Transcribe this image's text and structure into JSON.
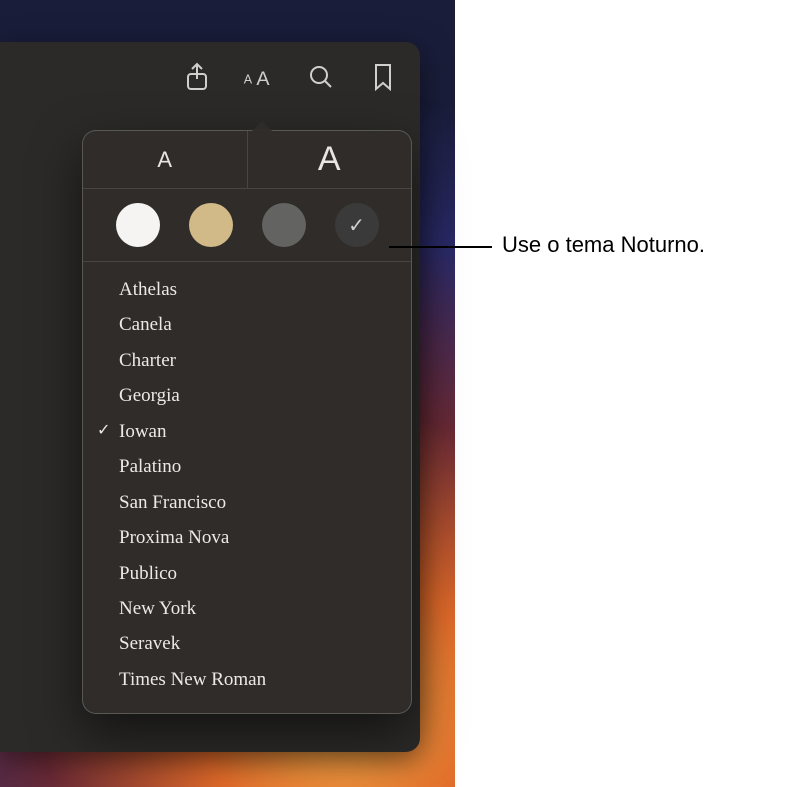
{
  "toolbar": {
    "share_name": "share-icon",
    "appearance_name": "appearance-icon",
    "search_name": "search-icon",
    "bookmark_name": "bookmark-icon"
  },
  "popover": {
    "size_small_label": "A",
    "size_large_label": "A",
    "themes": {
      "white": {
        "color": "#f5f4f2"
      },
      "sepia": {
        "color": "#d1b988"
      },
      "gray": {
        "color": "#636361"
      },
      "night": {
        "color": "#3a3a3a",
        "selected": true
      }
    },
    "fonts": [
      {
        "label": "Athelas",
        "selected": false
      },
      {
        "label": "Canela",
        "selected": false
      },
      {
        "label": "Charter",
        "selected": false
      },
      {
        "label": "Georgia",
        "selected": false
      },
      {
        "label": "Iowan",
        "selected": true
      },
      {
        "label": "Palatino",
        "selected": false
      },
      {
        "label": "San Francisco",
        "selected": false
      },
      {
        "label": "Proxima Nova",
        "selected": false
      },
      {
        "label": "Publico",
        "selected": false
      },
      {
        "label": "New York",
        "selected": false
      },
      {
        "label": "Seravek",
        "selected": false
      },
      {
        "label": "Times New Roman",
        "selected": false
      }
    ]
  },
  "callout": {
    "text": "Use o tema Noturno."
  }
}
